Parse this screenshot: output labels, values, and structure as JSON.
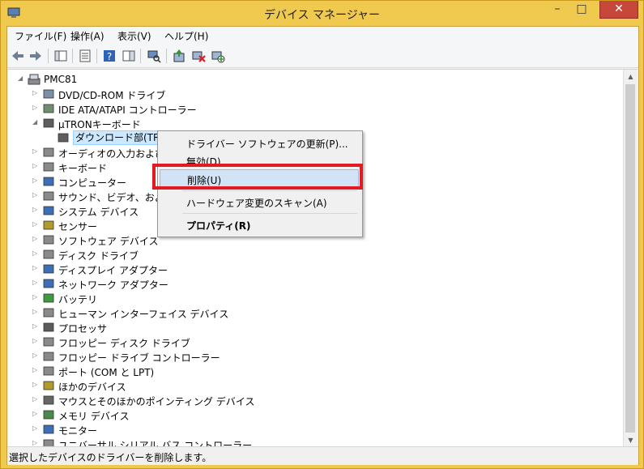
{
  "window": {
    "title": "デバイス マネージャー",
    "min_glyph": "–",
    "max_glyph": "□",
    "close_glyph": "✕"
  },
  "menu": [
    {
      "label": "ファイル(F)"
    },
    {
      "label": "操作(A)"
    },
    {
      "label": "表示(V)"
    },
    {
      "label": "ヘルプ(H)"
    }
  ],
  "toolbar_icons": [
    "back-arrow-icon",
    "forward-arrow-icon",
    "show-hide-tree-icon",
    "properties-icon",
    "help-icon",
    "action-pane-icon",
    "scan-hardware-icon",
    "update-driver-icon",
    "uninstall-icon",
    "add-legacy-hardware-icon"
  ],
  "tree": {
    "root": "PMC81",
    "items": [
      {
        "label": "DVD/CD-ROM ドライブ",
        "expander": "▷"
      },
      {
        "label": "IDE ATA/ATAPI コントローラー",
        "expander": "▷"
      },
      {
        "label": "µTRONキーボード",
        "expander": "◢"
      },
      {
        "label": "ダウンロード部(TRON...)",
        "expander": ""
      },
      {
        "label": "オーディオの入力および出",
        "expander": "▷"
      },
      {
        "label": "キーボード",
        "expander": "▷"
      },
      {
        "label": "コンピューター",
        "expander": "▷"
      },
      {
        "label": "サウンド、ビデオ、およびゲ",
        "expander": "▷"
      },
      {
        "label": "システム デバイス",
        "expander": "▷"
      },
      {
        "label": "センサー",
        "expander": "▷"
      },
      {
        "label": "ソフトウェア デバイス",
        "expander": "▷"
      },
      {
        "label": "ディスク ドライブ",
        "expander": "▷"
      },
      {
        "label": "ディスプレイ アダプター",
        "expander": "▷"
      },
      {
        "label": "ネットワーク アダプター",
        "expander": "▷"
      },
      {
        "label": "バッテリ",
        "expander": "▷"
      },
      {
        "label": "ヒューマン インターフェイス デバイス",
        "expander": "▷"
      },
      {
        "label": "プロセッサ",
        "expander": "▷"
      },
      {
        "label": "フロッピー ディスク ドライブ",
        "expander": "▷"
      },
      {
        "label": "フロッピー ドライブ コントローラー",
        "expander": "▷"
      },
      {
        "label": "ポート (COM と LPT)",
        "expander": "▷"
      },
      {
        "label": "ほかのデバイス",
        "expander": "▷"
      },
      {
        "label": "マウスとそのほかのポインティング デバイス",
        "expander": "▷"
      },
      {
        "label": "メモリ デバイス",
        "expander": "▷"
      },
      {
        "label": "モニター",
        "expander": "▷"
      },
      {
        "label": "ユニバーサル シリアル バス コントローラー",
        "expander": "▷"
      }
    ]
  },
  "context_menu": {
    "items": [
      {
        "label": "ドライバー ソフトウェアの更新(P)..."
      },
      {
        "label": "無効(D)"
      },
      {
        "label": "削除(U)"
      },
      {
        "label": "ハードウェア変更のスキャン(A)"
      },
      {
        "label": "プロパティ(R)"
      }
    ]
  },
  "status": {
    "text": "選択したデバイスのドライバーを削除します。"
  },
  "colors": {
    "highlight": "#e21a22",
    "title_bar": "#f0c94f",
    "selection": "#cce8ff",
    "close_button": "#c7473a"
  }
}
